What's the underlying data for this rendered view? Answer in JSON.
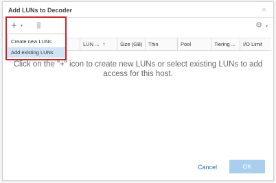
{
  "dialog": {
    "title": "Add LUNs to Decoder",
    "close_glyph": "×"
  },
  "toolbar": {
    "add_glyph": "+",
    "add_caret": "▾",
    "delete_icon": "trash-icon",
    "gear_glyph": "⚙",
    "gear_caret": "▾"
  },
  "menu": {
    "items": [
      {
        "label": "Create new LUNs"
      },
      {
        "label": "Add existing LUNs"
      }
    ]
  },
  "grid": {
    "columns": [
      {
        "label": "LUN ..."
      },
      {
        "label": "Size (GB)"
      },
      {
        "label": "Thin"
      },
      {
        "label": "Pool"
      },
      {
        "label": "Tiering ..."
      },
      {
        "label": "I/O Limit"
      }
    ],
    "sort_arrow": "↑",
    "empty_message": "Click on the \"+\" icon to create new LUNs or select existing LUNs to add access for this host."
  },
  "footer": {
    "cancel_label": "Cancel",
    "ok_label": "OK"
  },
  "colors": {
    "highlight": "#c8262e",
    "accent_link": "#1f6fb5",
    "ok_button_disabled": "#a9cfec",
    "menu_hover": "#cfe3f4"
  }
}
